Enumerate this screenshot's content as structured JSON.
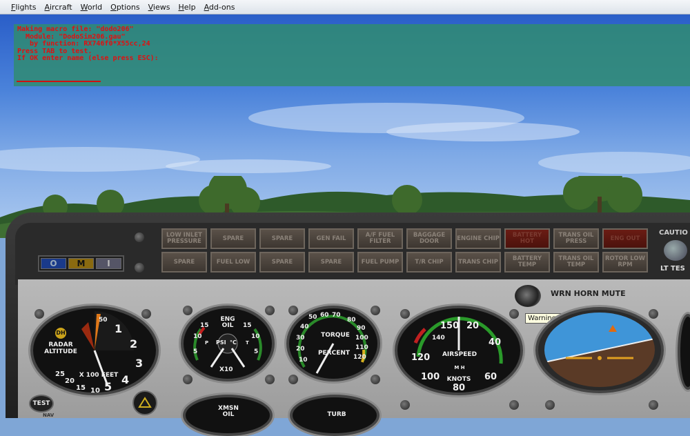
{
  "menu": {
    "items": [
      "Flights",
      "Aircraft",
      "World",
      "Options",
      "Views",
      "Help",
      "Add-ons"
    ]
  },
  "macro_panel": {
    "lines": [
      "Making macro file: \"dodo206\"",
      "  Module: \"DodoSim206.gau\"",
      "   by function: RX746f0*X55cc,24",
      "Press TAB to test.",
      "If OK enter name (else press ESC):"
    ]
  },
  "annunciators": {
    "row1": [
      "LOW INLET PRESSURE",
      "SPARE",
      "SPARE",
      "GEN FAIL",
      "A/F FUEL FILTER",
      "BAGGAGE DOOR",
      "ENGINE CHIP",
      "BATTERY HOT",
      "TRANS OIL PRESS",
      "ENG OUT"
    ],
    "row2": [
      "SPARE",
      "FUEL LOW",
      "SPARE",
      "SPARE",
      "FUEL PUMP",
      "T/R CHIP",
      "TRANS CHIP",
      "BATTERY TEMP",
      "TRANS OIL TEMP",
      "ROTOR LOW RPM"
    ],
    "caution_label": "CAUTIO",
    "lt_test_label": "LT TES"
  },
  "marker": {
    "o": "O",
    "m": "M",
    "i": "I"
  },
  "warn_horn_label": "WRN HORN MUTE",
  "tooltip": "Warning Mute Button (Off)",
  "radar_alt": {
    "dh": "DH",
    "title": "RADAR\nALTITUDE",
    "units": "X 100 FEET",
    "ticks": [
      "50",
      "1",
      "2",
      "3",
      "4",
      "5",
      "10",
      "15",
      "20",
      "25"
    ],
    "test": "TEST"
  },
  "eng_oil": {
    "title": "ENG\nOIL",
    "psi": "PSI",
    "deg": "°C",
    "x10": "X10",
    "p": "P",
    "t": "T",
    "ticks": [
      "15",
      "15",
      "10",
      "10",
      "5",
      "5"
    ]
  },
  "torque": {
    "title": "TORQUE",
    "sub": "PERCENT",
    "ticks": [
      "50",
      "60",
      "70",
      "80",
      "90",
      "100",
      "110",
      "120",
      "40",
      "30",
      "20",
      "10"
    ]
  },
  "airspeed": {
    "title": "AIRSPEED",
    "sub": "KNOTS",
    "mph": "M H",
    "ticks": [
      "150",
      "20",
      "40",
      "60",
      "80",
      "100",
      "120",
      "140"
    ]
  },
  "xmsn_oil": {
    "title": "XMSN\nOIL"
  },
  "turb": {
    "title": "TURB"
  },
  "nav_label": "NAV",
  "colors": {
    "sky_top": "#2a5ec8",
    "panel": "#9c9c9c",
    "macro_bg": "#308c6e",
    "macro_text": "#e01010",
    "lamp_red": "#6a1c14"
  }
}
